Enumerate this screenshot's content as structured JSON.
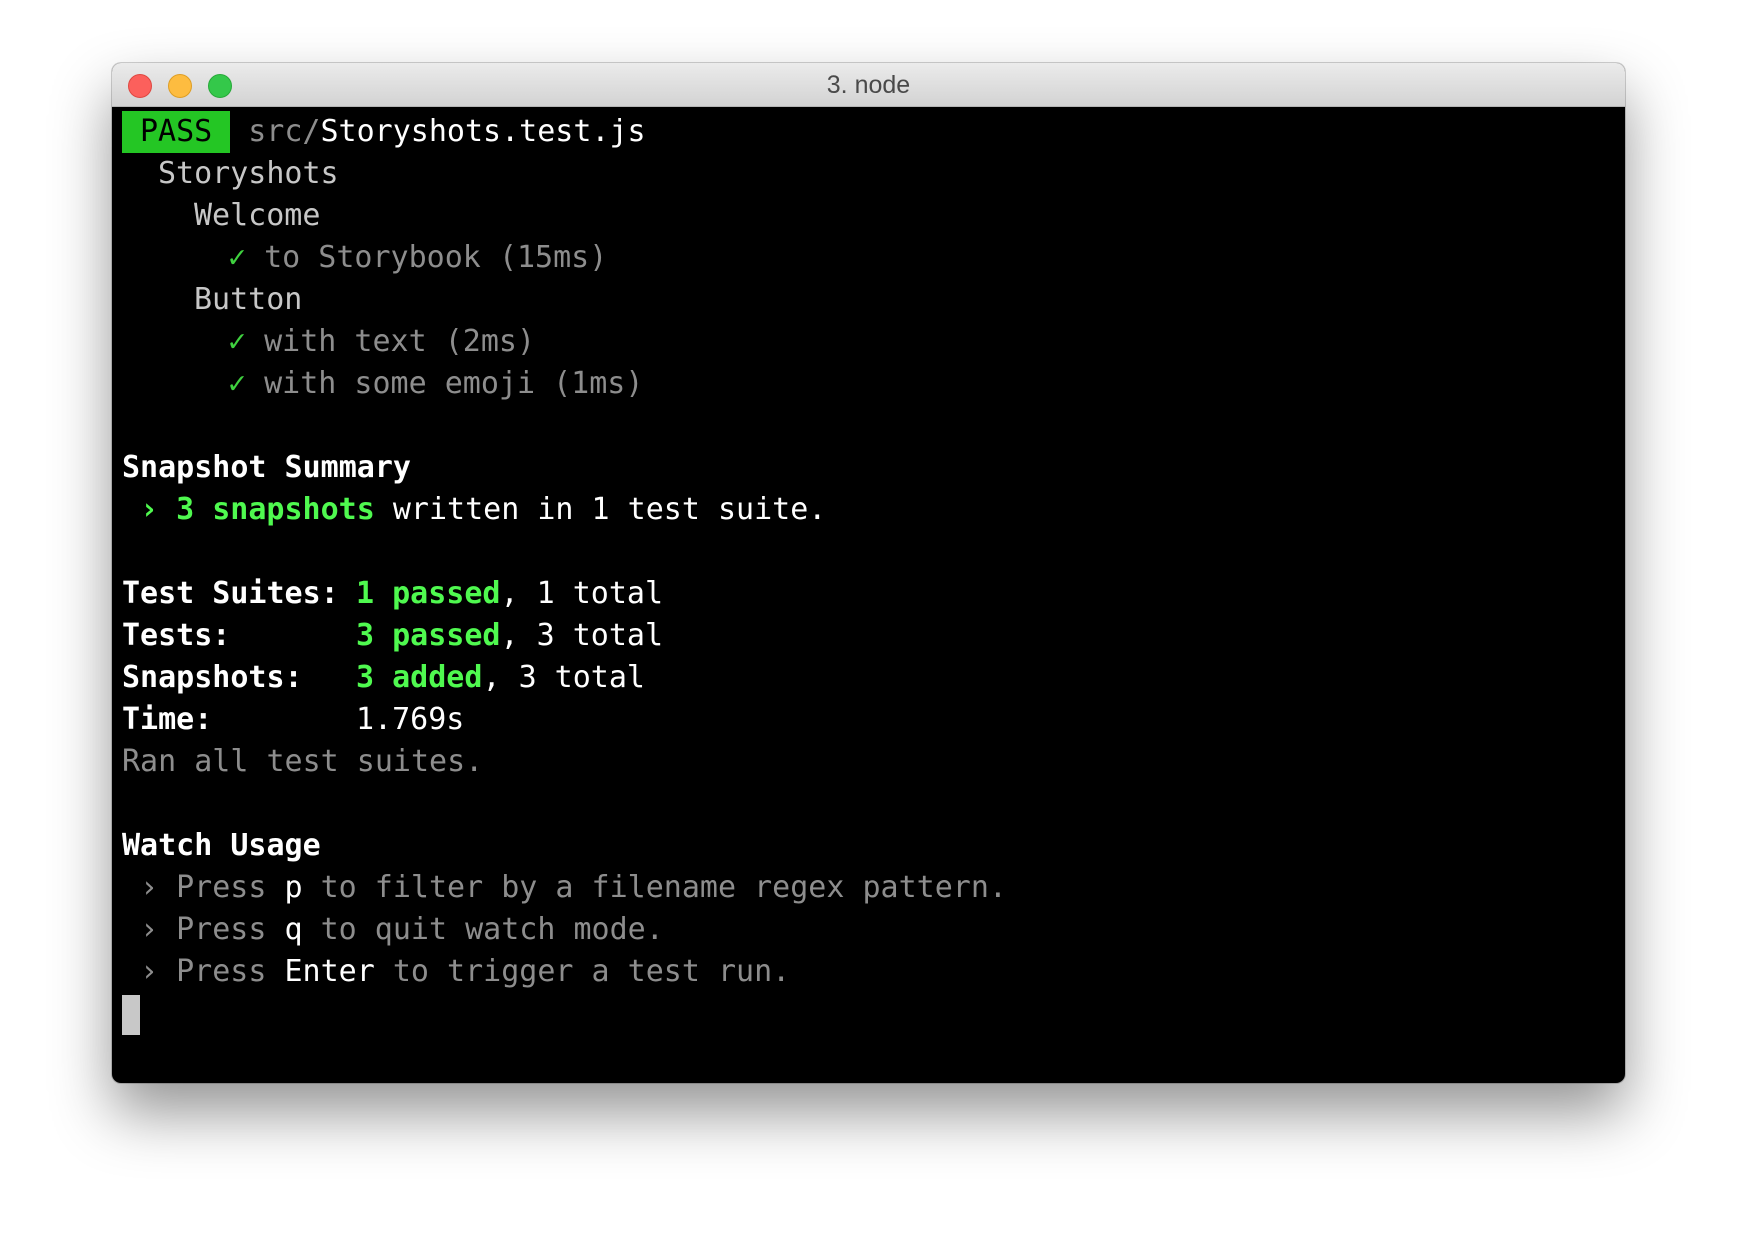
{
  "window": {
    "title": "3. node"
  },
  "header": {
    "badge": "PASS",
    "path_dir": "src/",
    "path_file": "Storyshots.test.js"
  },
  "tree": {
    "root": "Storyshots",
    "groups": [
      {
        "name": "Welcome",
        "tests": [
          {
            "check": "✓",
            "name": "to Storybook",
            "time": "(15ms)"
          }
        ]
      },
      {
        "name": "Button",
        "tests": [
          {
            "check": "✓",
            "name": "with text",
            "time": "(2ms)"
          },
          {
            "check": "✓",
            "name": "with some emoji",
            "time": "(1ms)"
          }
        ]
      }
    ]
  },
  "snapshot_summary": {
    "heading": "Snapshot Summary",
    "arrow": "›",
    "count": "3 snapshots",
    "rest": "written in 1 test suite."
  },
  "stats": {
    "suites_label": "Test Suites:",
    "suites_passed": "1 passed",
    "suites_total": "1 total",
    "tests_label": "Tests:",
    "tests_passed": "3 passed",
    "tests_total": "3 total",
    "snapshots_label": "Snapshots:",
    "snapshots_added": "3 added",
    "snapshots_total": "3 total",
    "time_label": "Time:",
    "time_value": "1.769s",
    "ran_all": "Ran all test suites."
  },
  "watch": {
    "heading": "Watch Usage",
    "items": [
      {
        "arrow": "›",
        "press": "Press",
        "key": "p",
        "action": "to filter by a filename regex pattern."
      },
      {
        "arrow": "›",
        "press": "Press",
        "key": "q",
        "action": "to quit watch mode."
      },
      {
        "arrow": "›",
        "press": "Press",
        "key": "Enter",
        "action": "to trigger a test run."
      }
    ]
  }
}
